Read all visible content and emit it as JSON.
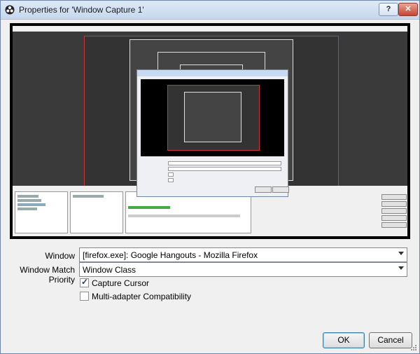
{
  "window": {
    "title": "Properties for 'Window Capture 1'"
  },
  "titlebar": {
    "help_label": "?",
    "close_label": "✕"
  },
  "form": {
    "window_label": "Window",
    "window_value": "[firefox.exe]: Google Hangouts - Mozilla Firefox",
    "priority_label": "Window Match Priority",
    "priority_value": "Window Class",
    "capture_cursor_label": "Capture Cursor",
    "capture_cursor_checked": true,
    "multi_adapter_label": "Multi-adapter Compatibility",
    "multi_adapter_checked": false
  },
  "buttons": {
    "ok_label": "OK",
    "cancel_label": "Cancel"
  },
  "icons": {
    "app": "obs-logo-icon",
    "close": "close-icon",
    "help": "help-icon",
    "dropdown": "chevron-down-icon"
  },
  "colors": {
    "preview_border": "#cc3333",
    "title_gradient_top": "#dde9f7",
    "ok_border": "#3c7fb1"
  }
}
